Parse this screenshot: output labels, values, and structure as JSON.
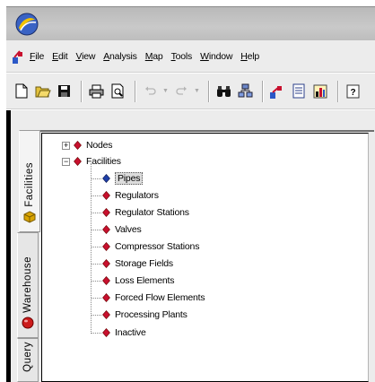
{
  "menubar": {
    "items": [
      {
        "pre": "",
        "u": "F",
        "post": "ile"
      },
      {
        "pre": "",
        "u": "E",
        "post": "dit"
      },
      {
        "pre": "",
        "u": "V",
        "post": "iew"
      },
      {
        "pre": "",
        "u": "A",
        "post": "nalysis"
      },
      {
        "pre": "",
        "u": "M",
        "post": "ap"
      },
      {
        "pre": "",
        "u": "T",
        "post": "ools"
      },
      {
        "pre": "",
        "u": "W",
        "post": "indow"
      },
      {
        "pre": "",
        "u": "H",
        "post": "elp"
      }
    ]
  },
  "side_tabs": {
    "facilities": "Facilities",
    "warehouse": "Warehouse",
    "query": "Query"
  },
  "tree": {
    "roots": [
      {
        "label": "Nodes",
        "expander": "+"
      },
      {
        "label": "Facilities",
        "expander": "−"
      }
    ],
    "children": [
      {
        "label": "Pipes",
        "selected": true
      },
      {
        "label": "Regulators"
      },
      {
        "label": "Regulator Stations"
      },
      {
        "label": "Valves"
      },
      {
        "label": "Compressor Stations"
      },
      {
        "label": "Storage Fields"
      },
      {
        "label": "Loss Elements"
      },
      {
        "label": "Forced Flow Elements"
      },
      {
        "label": "Processing Plants"
      },
      {
        "label": "Inactive"
      }
    ]
  },
  "colors": {
    "node_icon": "#c8102e",
    "selected_icon": "#1f3fa8",
    "facilities_tab_icon": "#d9a400",
    "warehouse_tab_icon": "#cc1b1b"
  }
}
